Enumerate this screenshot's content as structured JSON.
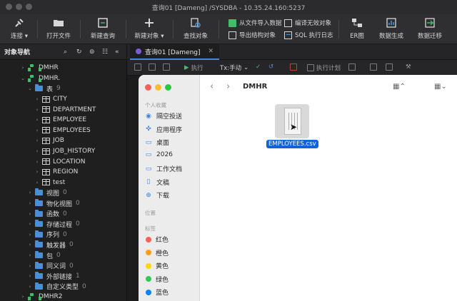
{
  "window": {
    "title": "查询01 [Dameng] /SYSDBA - 10.35.24.160:5237"
  },
  "toolbar": {
    "connect": "连接",
    "open_file": "打开文件",
    "new_query": "新建查询",
    "new_object": "新建对象",
    "find_object": "查找对象",
    "import_data": "从文件导入数据",
    "export_structure": "导出结构对象",
    "compile_invalid": "编译无效对象",
    "sql_log": "SQL 执行日志",
    "er_diagram": "ER图",
    "data_generate": "数据生成",
    "data_migrate": "数据迁移"
  },
  "sidebar": {
    "title": "对象导航",
    "tree": [
      {
        "label": "DMHR",
        "type": "schema",
        "count": ""
      },
      {
        "label": "DMHR.",
        "type": "schema",
        "count": ""
      },
      {
        "label": "表",
        "type": "folder",
        "count": "9"
      },
      {
        "label": "CITY",
        "type": "table",
        "count": ""
      },
      {
        "label": "DEPARTMENT",
        "type": "table",
        "count": ""
      },
      {
        "label": "EMPLOYEE",
        "type": "table",
        "count": ""
      },
      {
        "label": "EMPLOYEES",
        "type": "table",
        "count": ""
      },
      {
        "label": "JOB",
        "type": "table",
        "count": ""
      },
      {
        "label": "JOB_HISTORY",
        "type": "table",
        "count": ""
      },
      {
        "label": "LOCATION",
        "type": "table",
        "count": ""
      },
      {
        "label": "REGION",
        "type": "table",
        "count": ""
      },
      {
        "label": "test",
        "type": "table",
        "count": ""
      },
      {
        "label": "视图",
        "type": "folder",
        "count": "0"
      },
      {
        "label": "物化视图",
        "type": "folder",
        "count": "0"
      },
      {
        "label": "函数",
        "type": "folder",
        "count": "0"
      },
      {
        "label": "存储过程",
        "type": "folder",
        "count": "0"
      },
      {
        "label": "序列",
        "type": "folder",
        "count": "0"
      },
      {
        "label": "触发器",
        "type": "folder",
        "count": "0"
      },
      {
        "label": "包",
        "type": "folder",
        "count": "0"
      },
      {
        "label": "同义词",
        "type": "folder",
        "count": "0"
      },
      {
        "label": "外部链接",
        "type": "folder",
        "count": "1"
      },
      {
        "label": "自定义类型",
        "type": "folder",
        "count": "0"
      },
      {
        "label": "DMHR2",
        "type": "schema",
        "count": ""
      }
    ]
  },
  "editor": {
    "tab_label": "查询01 [Dameng]",
    "execute": "执行",
    "tx_mode": "Tx:手动",
    "explain": "执行计划"
  },
  "dialog": {
    "path": "DMHR",
    "favorites_title": "个人收藏",
    "favorites": [
      {
        "label": "隔空投送",
        "icon": "airdrop-icon"
      },
      {
        "label": "应用程序",
        "icon": "apps-icon"
      },
      {
        "label": "桌面",
        "icon": "desktop-icon"
      },
      {
        "label": "2026",
        "icon": "folder-icon"
      },
      {
        "label": "工作文档",
        "icon": "folder-icon"
      },
      {
        "label": "文稿",
        "icon": "document-icon"
      },
      {
        "label": "下载",
        "icon": "download-icon"
      }
    ],
    "locations_title": "位置",
    "tags_title": "标签",
    "tags": [
      {
        "label": "红色",
        "color": "#ff5f57"
      },
      {
        "label": "橙色",
        "color": "#ff9f0a"
      },
      {
        "label": "黄色",
        "color": "#ffd60a"
      },
      {
        "label": "绿色",
        "color": "#34c759"
      },
      {
        "label": "蓝色",
        "color": "#0a84ff"
      }
    ],
    "file": {
      "name": "EMPLOYEES.csv"
    }
  },
  "colors": {
    "accent": "#1463d6",
    "schema": "#3fbf6a",
    "folder": "#4a8ed8"
  }
}
